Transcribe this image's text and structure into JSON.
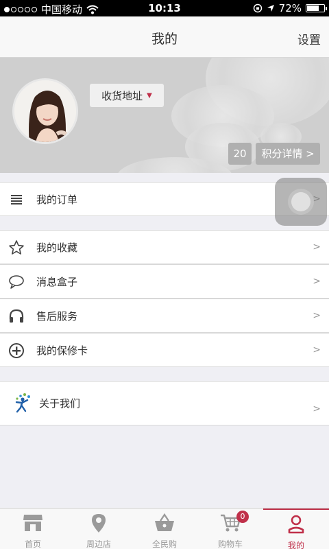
{
  "status_bar": {
    "carrier": "中国移动",
    "time": "10:13",
    "battery": "72%",
    "battery_level": 0.72
  },
  "header": {
    "title": "我的",
    "settings_label": "设置"
  },
  "profile": {
    "address_label": "收货地址",
    "points_value": "20",
    "points_detail_label": "积分详情 >"
  },
  "menu": {
    "orders": {
      "label": "我的订单",
      "arrow": ">",
      "icon": "list-icon"
    },
    "favorites": {
      "label": "我的收藏",
      "arrow": ">",
      "icon": "star-icon"
    },
    "messages": {
      "label": "消息盒子",
      "arrow": ">",
      "icon": "chat-bubble-icon"
    },
    "after_sales": {
      "label": "售后服务",
      "arrow": ">",
      "icon": "headphones-icon"
    },
    "warranty": {
      "label": "我的保修卡",
      "arrow": ">",
      "icon": "plus-circle-icon"
    },
    "about": {
      "label": "关于我们",
      "arrow": ">",
      "icon": "brand-logo-icon"
    }
  },
  "tabs": [
    {
      "label": "首页",
      "icon": "store-icon"
    },
    {
      "label": "周边店",
      "icon": "location-pin-icon"
    },
    {
      "label": "全民购",
      "icon": "basket-icon"
    },
    {
      "label": "购物车",
      "icon": "cart-icon",
      "badge": "0"
    },
    {
      "label": "我的",
      "icon": "user-icon",
      "active": true
    }
  ],
  "colors": {
    "accent": "#c0304a",
    "background": "#efeff4",
    "tab_inactive": "#9a9a9a"
  }
}
